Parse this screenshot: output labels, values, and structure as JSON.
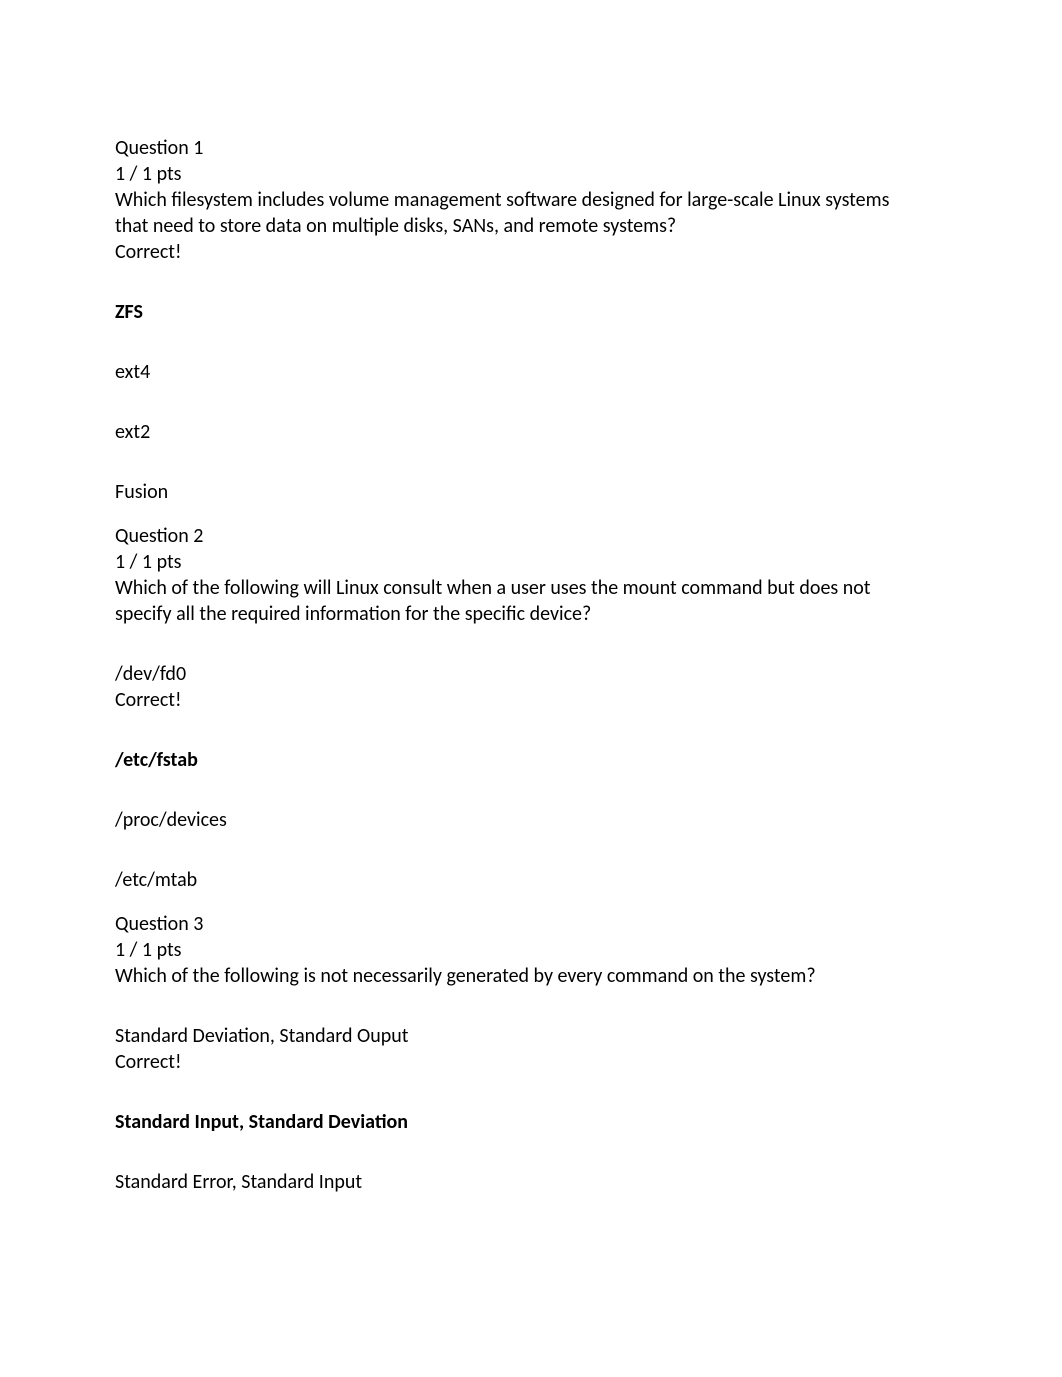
{
  "questions": [
    {
      "header": "Question 1",
      "points": "1 / 1 pts",
      "prompt_line1": "Which filesystem includes volume management software designed for large-scale Linux systems",
      "prompt_line2": "that need to store data on multiple disks, SANs, and remote systems?",
      "correct_label": "Correct!",
      "correct_answer": "ZFS",
      "options": [
        "ext4",
        "ext2",
        "Fusion"
      ]
    },
    {
      "header": "Question 2",
      "points": "1 / 1 pts",
      "prompt_line1": "Which of the following will Linux consult when a user uses the mount command but does not",
      "prompt_line2": "specify all the required information for the specific device?",
      "pre_option": "/dev/fd0",
      "correct_label": "Correct!",
      "correct_answer": "/etc/fstab",
      "options": [
        "/proc/devices",
        "/etc/mtab"
      ]
    },
    {
      "header": "Question 3",
      "points": "1 / 1 pts",
      "prompt_line1": "Which of the following is not necessarily generated by every command on the system?",
      "pre_option": "Standard Deviation, Standard Ouput",
      "correct_label": "Correct!",
      "correct_answer": "Standard Input, Standard Deviation",
      "options": [
        "Standard Error, Standard Input"
      ]
    }
  ]
}
